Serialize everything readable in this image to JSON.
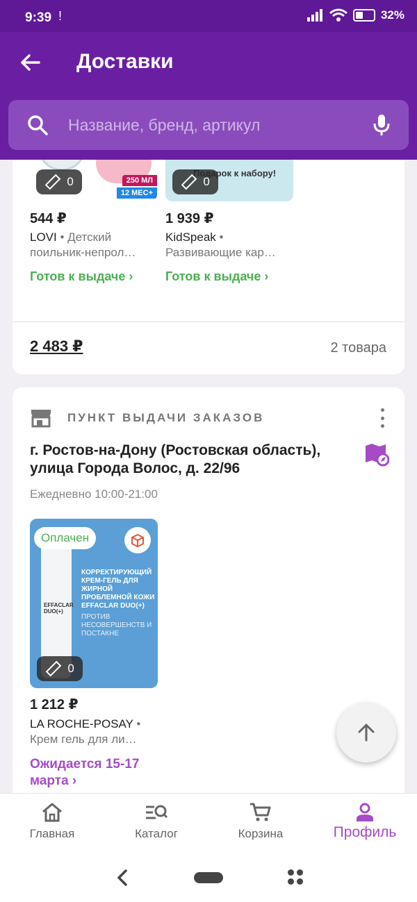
{
  "status_bar": {
    "time": "9:39",
    "extra": "!",
    "battery": "32%"
  },
  "header": {
    "title": "Доставки"
  },
  "search": {
    "placeholder": "Название, бренд, артикул"
  },
  "delivery_group_1": {
    "items": [
      {
        "ruler_count": "0",
        "price": "544 ₽",
        "brand": "LOVI",
        "desc": "Детский поильник-непрол…",
        "status": "Готов к выдаче ›",
        "thumb_text_1": "250 МЛ",
        "thumb_text_2": "12 МЕС+"
      },
      {
        "ruler_count": "0",
        "price": "1 939 ₽",
        "brand": "KidSpeak",
        "desc": "Развивающие кар…",
        "status": "Готов к выдаче ›",
        "thumb_text_1": "Подарок к набору!"
      }
    ],
    "total": "2 483 ₽",
    "count": "2 товара"
  },
  "delivery_group_2": {
    "section_label": "ПУНКТ ВЫДАЧИ ЗАКАЗОВ",
    "address": "г. Ростов-на-Дону (Ростовская область), улица Города Волос, д. 22/96",
    "hours": "Ежедневно 10:00-21:00",
    "item": {
      "paid_label": "Оплачен",
      "ruler_count": "0",
      "price": "1 212 ₽",
      "brand": "LA ROCHE-POSAY",
      "desc": "Крем гель для ли…",
      "expected": "Ожидается 15-17 марта ›",
      "pack_text_1": "КОРРЕКТИРУЮЩИЙ КРЕМ-ГЕЛЬ ДЛЯ ЖИРНОЙ ПРОБЛЕМНОЙ КОЖИ EFFACLAR DUO(+)",
      "pack_text_2": "ПРОТИВ НЕСОВЕРШЕНСТВ И ПОСТАКНЕ",
      "tube_label": "EFFACLAR DUO(+)"
    }
  },
  "bottom_nav": {
    "items": [
      {
        "label": "Главная",
        "icon": "home-icon"
      },
      {
        "label": "Каталог",
        "icon": "catalog-search-icon"
      },
      {
        "label": "Корзина",
        "icon": "cart-icon"
      },
      {
        "label": "Профиль",
        "icon": "profile-icon"
      }
    ],
    "active": "Профиль"
  },
  "colors": {
    "primary": "#6a1fa2",
    "accent": "#a54bc6",
    "success": "#4caf50"
  }
}
